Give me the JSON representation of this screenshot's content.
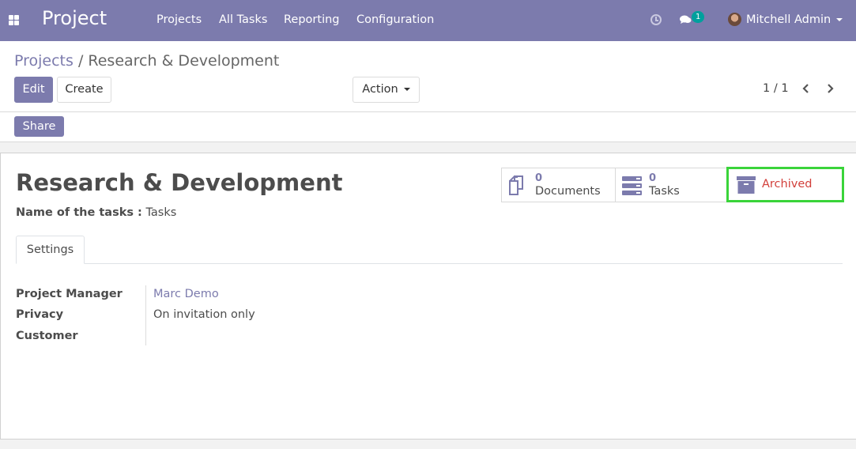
{
  "navbar": {
    "brand": "Project",
    "menu": [
      "Projects",
      "All Tasks",
      "Reporting",
      "Configuration"
    ],
    "chat_count": "1",
    "user_name": "Mitchell Admin"
  },
  "breadcrumb": {
    "parent": "Projects",
    "separator": " / ",
    "current": "Research & Development"
  },
  "buttons": {
    "edit": "Edit",
    "create": "Create",
    "action": "Action",
    "share": "Share"
  },
  "pager": {
    "value": "1 / 1"
  },
  "record": {
    "title": "Research & Development",
    "tasks_label": "Name of the tasks :",
    "tasks_value": "Tasks"
  },
  "stat_buttons": {
    "documents": {
      "count": "0",
      "label": "Documents"
    },
    "tasks": {
      "count": "0",
      "label": "Tasks"
    },
    "archived": {
      "label": "Archived"
    }
  },
  "tabs": {
    "settings": "Settings"
  },
  "fields": {
    "project_manager": {
      "label": "Project Manager",
      "value": "Marc Demo"
    },
    "privacy": {
      "label": "Privacy",
      "value": "On invitation only"
    },
    "customer": {
      "label": "Customer",
      "value": ""
    }
  },
  "colors": {
    "brand": "#7c7bad",
    "archived_text": "#d23f3a",
    "highlight": "#3ad43a",
    "badge": "#00a09d"
  }
}
